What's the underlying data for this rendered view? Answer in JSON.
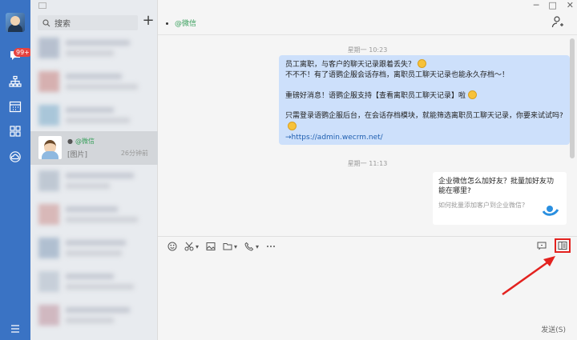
{
  "nav": {
    "badge": "99+",
    "icons": [
      "chat-icon",
      "org-icon",
      "calendar-icon",
      "apps-icon",
      "cloud-icon",
      "menu-icon"
    ]
  },
  "contacts": {
    "search_placeholder": "搜索",
    "active_chat": {
      "name": "@微信",
      "last_message": "[图片]",
      "time": "26分钟前"
    }
  },
  "chat": {
    "window_controls": [
      "─",
      "□",
      "✕"
    ],
    "title": "@微信",
    "timestamps": [
      "星期一 10:23",
      "星期一 11:13"
    ],
    "message": {
      "line1": "员工离职，与客户的聊天记录跟着丢失？",
      "line2": "不不不！有了语鹦企服会话存档，离职员工聊天记录也能永久存档～！",
      "line3": "重磅好消息！语鹦企服支持【查看离职员工聊天记录】啦",
      "line4": "只需登录语鹦企服后台，在会话存档模块，就能筛选离职员工聊天记录，你要来试试吗?",
      "link": "→https://admin.wecrm.net/"
    },
    "card": {
      "title": "企业微信怎么加好友？批量加好友功能在哪里?",
      "subtitle": "如何批量添加客户到企业微信?"
    },
    "send_label": "发送(S)"
  }
}
